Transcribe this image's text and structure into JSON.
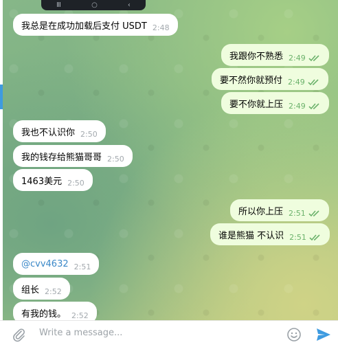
{
  "phone_nav": {
    "buttons": [
      "Ⅲ",
      "○",
      "‹"
    ]
  },
  "messages": [
    {
      "side": "in",
      "text": "我总是在成功加载后支付 USDT",
      "time": "2:48"
    },
    {
      "side": "out",
      "text": "我跟你不熟悉",
      "time": "2:49",
      "read": true
    },
    {
      "side": "out",
      "text": "要不然你就预付",
      "time": "2:49",
      "read": true
    },
    {
      "side": "out",
      "text": "要不你就上压",
      "time": "2:49",
      "read": true
    },
    {
      "side": "in",
      "text": "我也不认识你",
      "time": "2:50"
    },
    {
      "side": "in",
      "text": "我的钱存给熊猫哥哥",
      "time": "2:50"
    },
    {
      "side": "in",
      "text": "1463美元",
      "time": "2:50"
    },
    {
      "side": "out",
      "text": "所以你上压",
      "time": "2:51",
      "read": true
    },
    {
      "side": "out",
      "text": "谁是熊猫 不认识",
      "time": "2:51",
      "read": true
    },
    {
      "side": "in",
      "text": "@cvv4632",
      "time": "2:51",
      "mention": true
    },
    {
      "side": "in",
      "text": "组长",
      "time": "2:52"
    },
    {
      "side": "in",
      "text": "有我的钱。",
      "time": "2:52"
    }
  ],
  "composer": {
    "placeholder": "Write a message..."
  },
  "colors": {
    "accent": "#3e9be0",
    "outgoing_bubble": "#effdde",
    "incoming_bubble": "#ffffff",
    "send_icon": "#3e9be0",
    "check_marks": "#6bb26b"
  }
}
